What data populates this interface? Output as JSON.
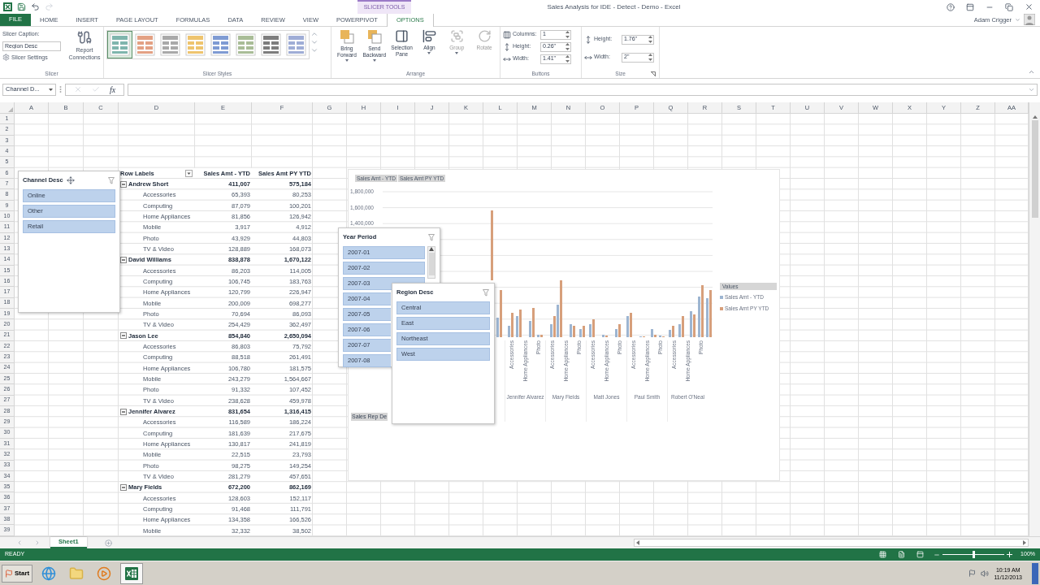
{
  "title_bar": {
    "contextual_tab_group": "SLICER TOOLS",
    "title": "Sales Analysis for IDE - Detect - Demo - Excel"
  },
  "ribbon_tabs": [
    {
      "label": "FILE",
      "kind": "file",
      "selected": false
    },
    {
      "label": "HOME",
      "kind": "tab",
      "selected": false
    },
    {
      "label": "INSERT",
      "kind": "tab",
      "selected": false
    },
    {
      "label": "PAGE LAYOUT",
      "kind": "tab",
      "selected": false
    },
    {
      "label": "FORMULAS",
      "kind": "tab",
      "selected": false
    },
    {
      "label": "DATA",
      "kind": "tab",
      "selected": false
    },
    {
      "label": "REVIEW",
      "kind": "tab",
      "selected": false
    },
    {
      "label": "VIEW",
      "kind": "tab",
      "selected": false
    },
    {
      "label": "POWERPIVOT",
      "kind": "tab",
      "selected": false
    },
    {
      "label": "OPTIONS",
      "kind": "contextual",
      "selected": true
    }
  ],
  "user": "Adam Crigger",
  "ribbon": {
    "slicer_group": {
      "label": "Slicer",
      "caption_label": "Slicer Caption:",
      "caption_value": "Region Desc",
      "settings": "Slicer Settings",
      "report_connections": "Report Connections"
    },
    "styles_group": {
      "label": "Slicer Styles",
      "styles": [
        {
          "color": "#7fb5ad",
          "selected": true
        },
        {
          "color": "#e3a184",
          "selected": false
        },
        {
          "color": "#a9a9a9",
          "selected": false
        },
        {
          "color": "#eec46e",
          "selected": false
        },
        {
          "color": "#7f9bd3",
          "selected": false
        },
        {
          "color": "#a9bd97",
          "selected": false
        },
        {
          "color": "#7d7d7d",
          "selected": false
        },
        {
          "color": "#9fadd6",
          "selected": false
        }
      ]
    },
    "arrange_group": {
      "label": "Arrange",
      "buttons": [
        {
          "label": "Bring Forward",
          "kind": "forward",
          "dropdown": true,
          "disabled": false
        },
        {
          "label": "Send Backward",
          "kind": "backward",
          "dropdown": true,
          "disabled": false
        },
        {
          "label": "Selection Pane",
          "kind": "pane",
          "dropdown": false,
          "disabled": false
        },
        {
          "label": "Align",
          "kind": "align",
          "dropdown": true,
          "disabled": false
        },
        {
          "label": "Group",
          "kind": "group",
          "dropdown": true,
          "disabled": true
        },
        {
          "label": "Rotate",
          "kind": "rotate",
          "dropdown": false,
          "disabled": true
        }
      ]
    },
    "buttons_group": {
      "label": "Buttons",
      "fields": [
        {
          "label": "Columns:",
          "kind": "columns",
          "value": "1"
        },
        {
          "label": "Height:",
          "kind": "height",
          "value": "0.26\""
        },
        {
          "label": "Width:",
          "kind": "width",
          "value": "1.41\""
        }
      ]
    },
    "size_group": {
      "label": "Size",
      "fields": [
        {
          "label": "Height:",
          "kind": "height",
          "value": "1.76\""
        },
        {
          "label": "Width:",
          "kind": "width",
          "value": "2\""
        }
      ]
    }
  },
  "formula_bar": {
    "name_box": "Channel D...",
    "function_label": "fx"
  },
  "sheet": {
    "columns": [
      "A",
      "B",
      "C",
      "D",
      "E",
      "F",
      "G",
      "H",
      "I",
      "J",
      "K",
      "L",
      "M",
      "N",
      "O",
      "P",
      "Q",
      "R",
      "S",
      "T",
      "U",
      "V",
      "W",
      "X",
      "Y",
      "Z",
      "AA"
    ],
    "rows": [
      "1",
      "2",
      "3",
      "4",
      "5",
      "6",
      "7",
      "8",
      "9",
      "10",
      "11",
      "12",
      "13",
      "14",
      "15",
      "16",
      "17",
      "18",
      "19",
      "20",
      "21",
      "22",
      "23",
      "24",
      "25",
      "26",
      "27",
      "28",
      "29",
      "30",
      "31",
      "32",
      "33",
      "34",
      "35",
      "36",
      "37",
      "38",
      "39"
    ]
  },
  "pivot_table": {
    "headers": [
      "Row Labels",
      "Sales Amt - YTD",
      "Sales Amt PY YTD"
    ],
    "groups": [
      {
        "name": "Andrew Short",
        "ytd": "411,007",
        "py_ytd": "575,184",
        "expanded": true,
        "children": [
          {
            "label": "Accessories",
            "ytd": "65,393",
            "py_ytd": "80,253"
          },
          {
            "label": "Computing",
            "ytd": "87,079",
            "py_ytd": "100,201"
          },
          {
            "label": "Home Appliances",
            "ytd": "81,856",
            "py_ytd": "126,942"
          },
          {
            "label": "Mobile",
            "ytd": "3,917",
            "py_ytd": "4,912"
          },
          {
            "label": "Photo",
            "ytd": "43,929",
            "py_ytd": "44,803"
          },
          {
            "label": "TV & Video",
            "ytd": "128,889",
            "py_ytd": "168,073"
          }
        ]
      },
      {
        "name": "David Williams",
        "ytd": "838,878",
        "py_ytd": "1,670,122",
        "expanded": true,
        "children": [
          {
            "label": "Accessories",
            "ytd": "86,203",
            "py_ytd": "114,005"
          },
          {
            "label": "Computing",
            "ytd": "106,745",
            "py_ytd": "183,763"
          },
          {
            "label": "Home Appliances",
            "ytd": "120,799",
            "py_ytd": "226,947"
          },
          {
            "label": "Mobile",
            "ytd": "200,009",
            "py_ytd": "698,277"
          },
          {
            "label": "Photo",
            "ytd": "70,694",
            "py_ytd": "86,093"
          },
          {
            "label": "TV & Video",
            "ytd": "254,429",
            "py_ytd": "362,497"
          }
        ]
      },
      {
        "name": "Jason Lee",
        "ytd": "854,840",
        "py_ytd": "2,650,094",
        "expanded": true,
        "children": [
          {
            "label": "Accessories",
            "ytd": "86,803",
            "py_ytd": "75,792"
          },
          {
            "label": "Computing",
            "ytd": "88,518",
            "py_ytd": "261,491"
          },
          {
            "label": "Home Appliances",
            "ytd": "106,780",
            "py_ytd": "181,575"
          },
          {
            "label": "Mobile",
            "ytd": "243,279",
            "py_ytd": "1,564,667"
          },
          {
            "label": "Photo",
            "ytd": "91,332",
            "py_ytd": "107,452"
          },
          {
            "label": "TV & Video",
            "ytd": "238,628",
            "py_ytd": "459,978"
          }
        ]
      },
      {
        "name": "Jennifer Alvarez",
        "ytd": "831,654",
        "py_ytd": "1,316,415",
        "expanded": true,
        "children": [
          {
            "label": "Accessories",
            "ytd": "116,589",
            "py_ytd": "186,224"
          },
          {
            "label": "Computing",
            "ytd": "181,639",
            "py_ytd": "217,675"
          },
          {
            "label": "Home Appliances",
            "ytd": "130,817",
            "py_ytd": "241,819"
          },
          {
            "label": "Mobile",
            "ytd": "22,515",
            "py_ytd": "23,793"
          },
          {
            "label": "Photo",
            "ytd": "98,275",
            "py_ytd": "149,254"
          },
          {
            "label": "TV & Video",
            "ytd": "281,279",
            "py_ytd": "457,651"
          }
        ]
      },
      {
        "name": "Mary Fields",
        "ytd": "672,200",
        "py_ytd": "862,169",
        "expanded": true,
        "children": [
          {
            "label": "Accessories",
            "ytd": "128,603",
            "py_ytd": "152,117"
          },
          {
            "label": "Computing",
            "ytd": "91,468",
            "py_ytd": "111,791"
          },
          {
            "label": "Home Appliances",
            "ytd": "134,358",
            "py_ytd": "166,526"
          },
          {
            "label": "Mobile",
            "ytd": "32,332",
            "py_ytd": "38,502"
          }
        ]
      }
    ]
  },
  "chart": {
    "field_buttons": [
      "Sales Amt - YTD",
      "Sales Amt PY YTD"
    ],
    "y_labels": [
      "1,800,000",
      "1,600,000",
      "1,400,000"
    ],
    "groups": [
      {
        "name": "Jennifer Alvarez",
        "categories": [
          "Accessories",
          "Home Appliances",
          "Photo"
        ]
      },
      {
        "name": "Mary Fields",
        "categories": [
          "Accessories",
          "Home Appliances",
          "Photo"
        ]
      },
      {
        "name": "Matt Jones",
        "categories": [
          "Accessories",
          "Home Appliances",
          "Photo"
        ]
      },
      {
        "name": "Paul Smith",
        "categories": [
          "Accessories",
          "Home Appliances",
          "Photo"
        ]
      },
      {
        "name": "Robert O'Neal",
        "categories": [
          "Accessories",
          "Home Appliances",
          "Photo"
        ]
      }
    ],
    "legend": {
      "title": "Values",
      "items": [
        {
          "label": "Sales Amt - YTD",
          "color": "#9db5d1"
        },
        {
          "label": "Sales Amt PY YTD",
          "color": "#d79f7b"
        }
      ]
    },
    "axis_field_button": "Sales Rep De"
  },
  "slicers": [
    {
      "title": "Channel Desc",
      "scrollable": false,
      "items": [
        {
          "label": "Online",
          "selected": true
        },
        {
          "label": "Other",
          "selected": true
        },
        {
          "label": "Retail",
          "selected": true
        }
      ]
    },
    {
      "title": "Year Period",
      "scrollable": true,
      "items": [
        {
          "label": "2007-01",
          "selected": true
        },
        {
          "label": "2007-02",
          "selected": true
        },
        {
          "label": "2007-03",
          "selected": true
        },
        {
          "label": "2007-04",
          "selected": true
        },
        {
          "label": "2007-05",
          "selected": true
        },
        {
          "label": "2007-06",
          "selected": true
        },
        {
          "label": "2007-07",
          "selected": true
        },
        {
          "label": "2007-08",
          "selected": true
        }
      ]
    },
    {
      "title": "Region Desc",
      "scrollable": false,
      "items": [
        {
          "label": "Central",
          "selected": true
        },
        {
          "label": "East",
          "selected": true
        },
        {
          "label": "Northeast",
          "selected": true
        },
        {
          "label": "West",
          "selected": true
        }
      ]
    }
  ],
  "sheet_tabs": [
    {
      "label": "Sheet1",
      "selected": true
    }
  ],
  "status_bar": {
    "status": "READY",
    "zoom": {
      "level": 0.5,
      "reading": "100%"
    }
  },
  "taskbar": {
    "start": "Start",
    "apps": [
      {
        "kind": "browser",
        "selected": false
      },
      {
        "kind": "folder",
        "selected": false
      },
      {
        "kind": "media",
        "selected": false
      },
      {
        "kind": "excel",
        "selected": true
      }
    ],
    "time": "10:19 AM",
    "date": "11/12/2013"
  }
}
